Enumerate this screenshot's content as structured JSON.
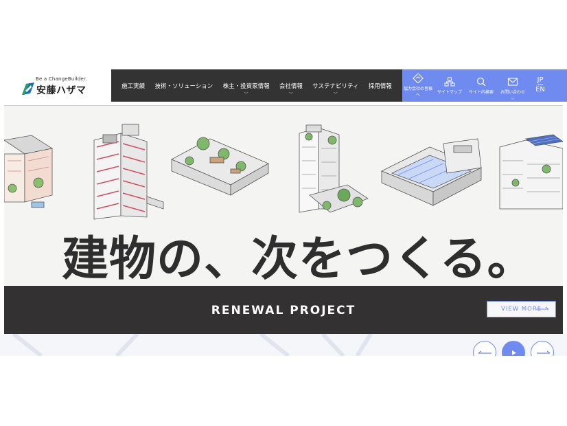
{
  "logo": {
    "tagline": "Be a ChangeBuilder.",
    "name": "安藤ハザマ"
  },
  "gnav": [
    {
      "label": "施工実績",
      "has_dropdown": false
    },
    {
      "label": "技術・ソリューション",
      "has_dropdown": false
    },
    {
      "label": "株主・投資家情報",
      "has_dropdown": true
    },
    {
      "label": "会社情報",
      "has_dropdown": true
    },
    {
      "label": "サステナビリティ",
      "has_dropdown": true
    },
    {
      "label": "採用情報",
      "has_dropdown": false
    }
  ],
  "utility": [
    {
      "label": "協力会社の皆様へ",
      "icon": "handshake-icon"
    },
    {
      "label": "サイトマップ",
      "icon": "sitemap-icon"
    },
    {
      "label": "サイト内検索",
      "icon": "search-icon"
    },
    {
      "label": "お問い合わせ",
      "icon": "mail-icon",
      "has_dropdown": true
    }
  ],
  "language": {
    "current": "JP",
    "other": "EN"
  },
  "hero": {
    "catchcopy": "建物の、次をつくる。",
    "band_title": "RENEWAL PROJECT",
    "view_more": "VIEW MORE"
  },
  "colors": {
    "accent": "#6f8bf0",
    "dark": "#333334",
    "band": "#333132"
  }
}
